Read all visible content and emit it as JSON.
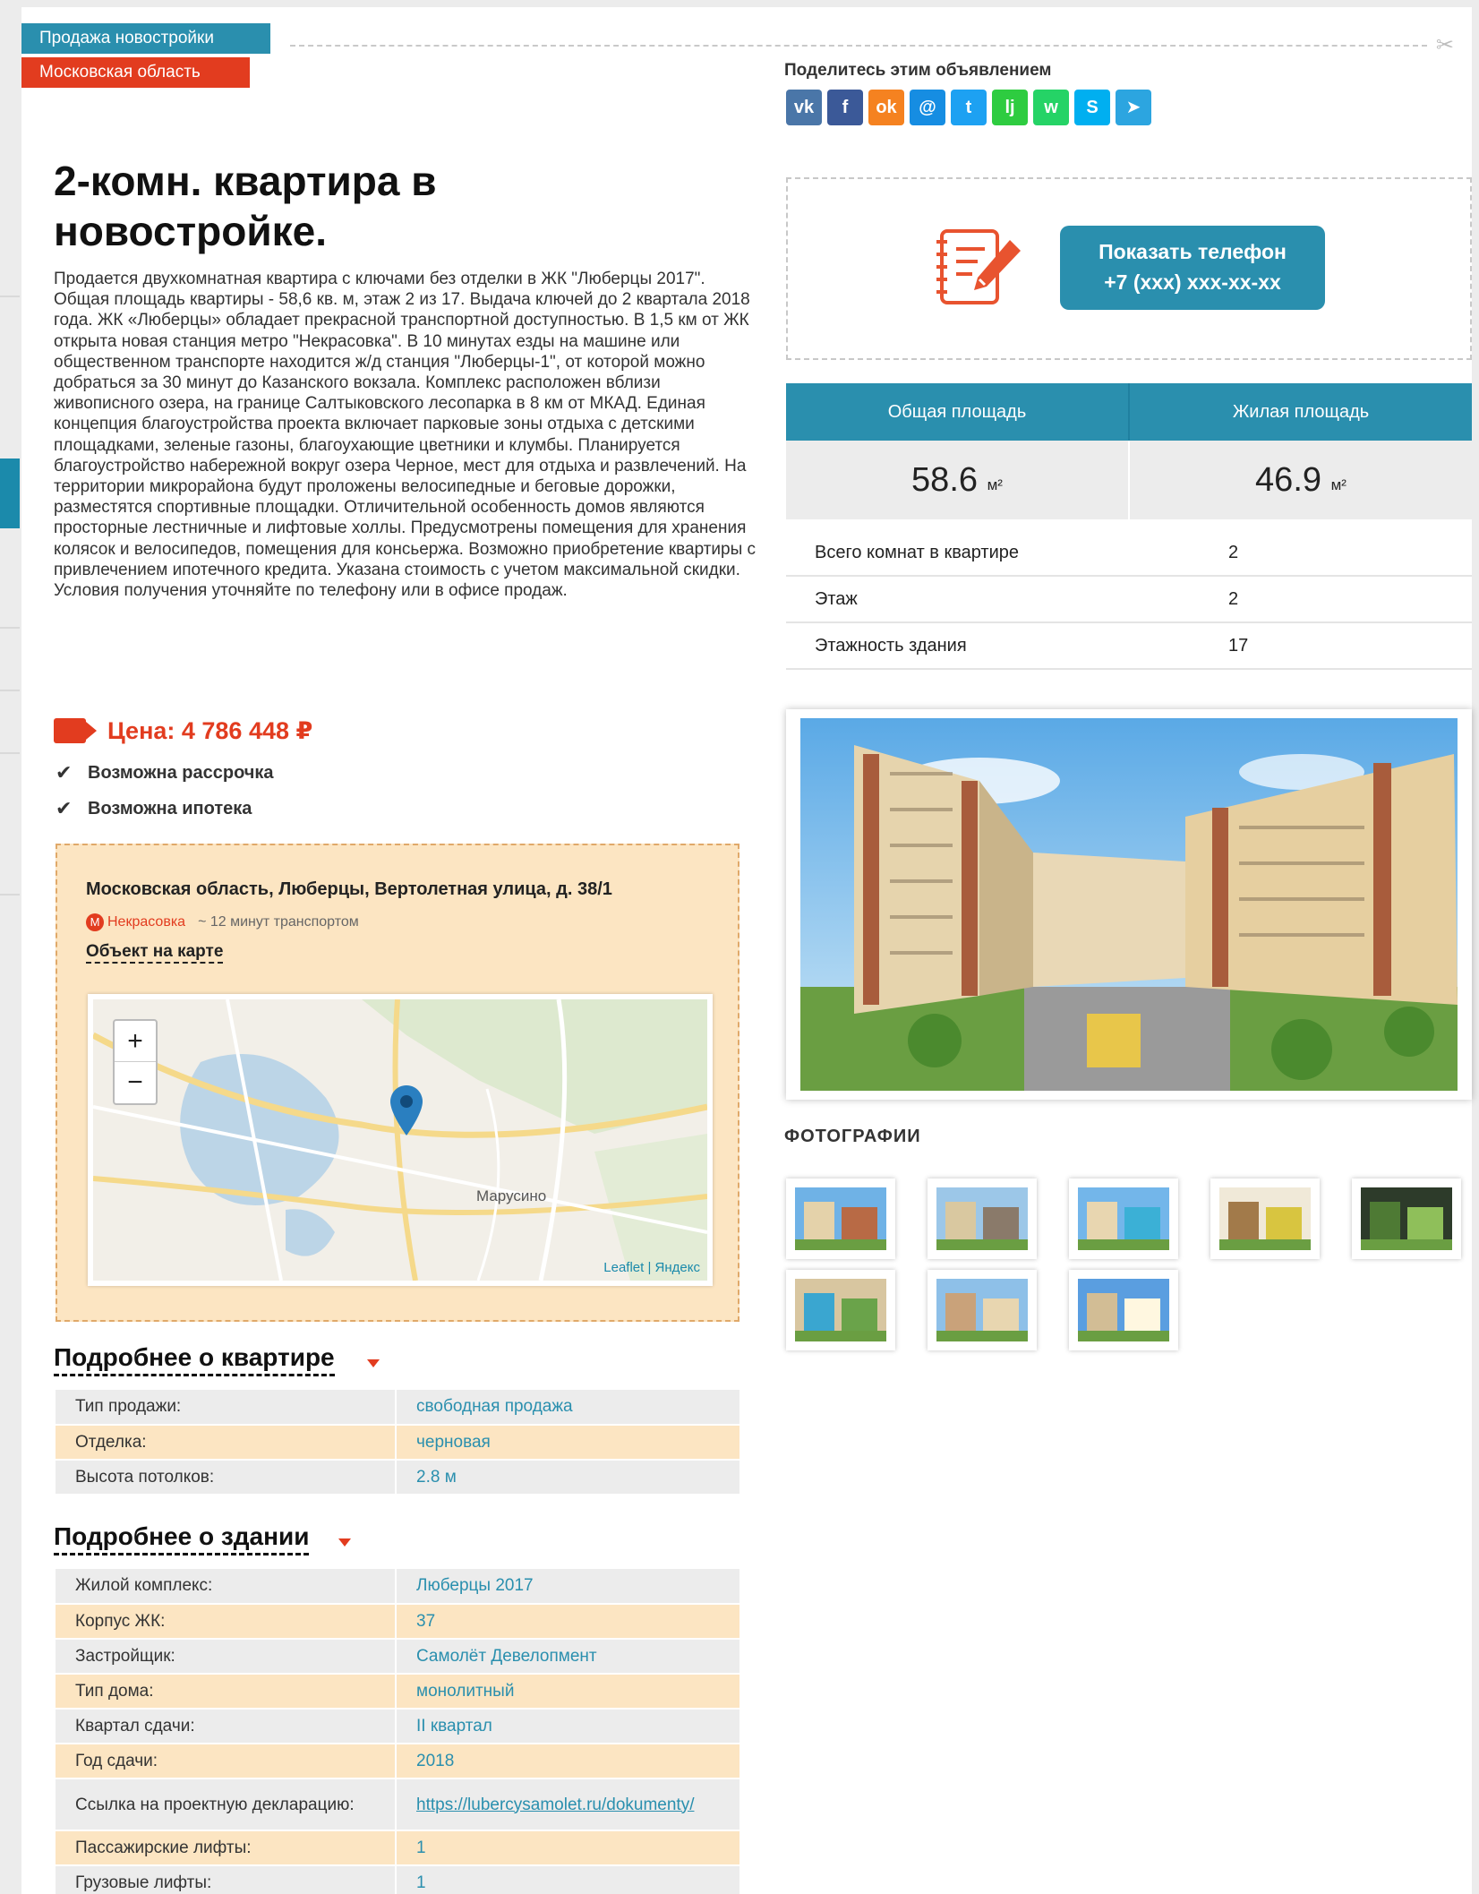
{
  "tags": {
    "type": "Продажа новостройки",
    "region": "Московская область"
  },
  "title": "2-комн. квартира в новостройке.",
  "description": "Продается двухкомнатная квартира с ключами без отделки в ЖК \"Люберцы 2017\". Общая площадь квартиры - 58,6 кв. м, этаж 2 из 17. Выдача ключей до 2 квартала 2018 года. ЖК «Люберцы» обладает прекрасной транспортной доступностью. В 1,5 км от ЖК открыта новая станция метро \"Некрасовка\". В 10 минутах езды на машине или общественном транспорте находится ж/д станция \"Люберцы-1\", от которой можно добраться за 30 минут до Казанского вокзала. Комплекс расположен вблизи живописного озера, на границе Салтыковского лесопарка в 8 км от МКАД. Единая концепция благоустройства проекта включает парковые зоны отдыха с детскими площадками, зеленые газоны, благоухающие цветники и клумбы. Планируется благоустройство набережной вокруг озера Черное, мест для отдыха и развлечений. На территории микрорайона будут проложены велосипедные и беговые дорожки, разместятся спортивные площадки. Отличительной особенность домов являются просторные лестничные и лифтовые холлы. Предусмотрены помещения для хранения колясок и велосипедов, помещения для консьержа. Возможно приобретение квартиры с привлечением ипотечного кредита. Указана стоимость с учетом максимальной скидки. Условия получения уточняйте по телефону или в офисе продаж.",
  "price": "Цена: 4 786 448 ₽",
  "features": [
    "Возможна рассрочка",
    "Возможна ипотека"
  ],
  "address": {
    "full": "Московская область, Люберцы, Вертолетная улица, д. 38/1",
    "metro_icon": "М",
    "metro": "Некрасовка",
    "metro_time": "~ 12 минут транспортом",
    "map_link": "Объект на карте",
    "map_label": "Марусино",
    "attribution": "Leaflet | Яндекс",
    "zoom_in": "+",
    "zoom_out": "−"
  },
  "apartment_section": {
    "heading": "Подробнее о квартире",
    "rows": [
      {
        "label": "Тип продажи:",
        "value": "свободная продажа"
      },
      {
        "label": "Отделка:",
        "value": "черновая"
      },
      {
        "label": "Высота потолков:",
        "value": "2.8 м"
      }
    ]
  },
  "building_section": {
    "heading": "Подробнее о здании",
    "rows": [
      {
        "label": "Жилой комплекс:",
        "value": "Люберцы 2017"
      },
      {
        "label": "Корпус ЖК:",
        "value": "37"
      },
      {
        "label": "Застройщик:",
        "value": "Самолёт Девелопмент"
      },
      {
        "label": "Тип дома:",
        "value": "монолитный"
      },
      {
        "label": "Квартал сдачи:",
        "value": "II квартал"
      },
      {
        "label": "Год сдачи:",
        "value": "2018"
      },
      {
        "label": "Ссылка на проектную декларацию:",
        "value": "https://lubercysamolet.ru/dokumenty/"
      },
      {
        "label": "Пассажирские лифты:",
        "value": "1"
      },
      {
        "label": "Грузовые лифты:",
        "value": "1"
      }
    ]
  },
  "share": {
    "label": "Поделитесь этим объявлением",
    "networks": [
      {
        "name": "vk",
        "glyph": "vk",
        "color": "#4a76a8"
      },
      {
        "name": "facebook",
        "glyph": "f",
        "color": "#3b5998"
      },
      {
        "name": "odnoklassniki",
        "glyph": "ok",
        "color": "#f58220"
      },
      {
        "name": "moimir",
        "glyph": "@",
        "color": "#168de2"
      },
      {
        "name": "twitter",
        "glyph": "t",
        "color": "#1da1f2"
      },
      {
        "name": "livejournal",
        "glyph": "lj",
        "color": "#2ecc40"
      },
      {
        "name": "whatsapp",
        "glyph": "w",
        "color": "#25d366"
      },
      {
        "name": "skype",
        "glyph": "S",
        "color": "#00aff0"
      },
      {
        "name": "telegram",
        "glyph": "➤",
        "color": "#2ca5e0"
      }
    ]
  },
  "phone": {
    "button_line1": "Показать телефон",
    "button_line2": "+7 (xxx) xxx-xx-xx"
  },
  "area": {
    "total_label": "Общая площадь",
    "living_label": "Жилая площадь",
    "total_value": "58.6",
    "living_value": "46.9",
    "unit": "м²"
  },
  "specs": [
    {
      "label": "Всего комнат в квартире",
      "value": "2"
    },
    {
      "label": "Этаж",
      "value": "2"
    },
    {
      "label": "Этажность здания",
      "value": "17"
    }
  ],
  "photos_label": "ФОТОГРАФИИ",
  "thumb_count": 8,
  "colors": {
    "accent": "#2a8fae",
    "red": "#e23c1f",
    "peach": "#fce5c2"
  }
}
